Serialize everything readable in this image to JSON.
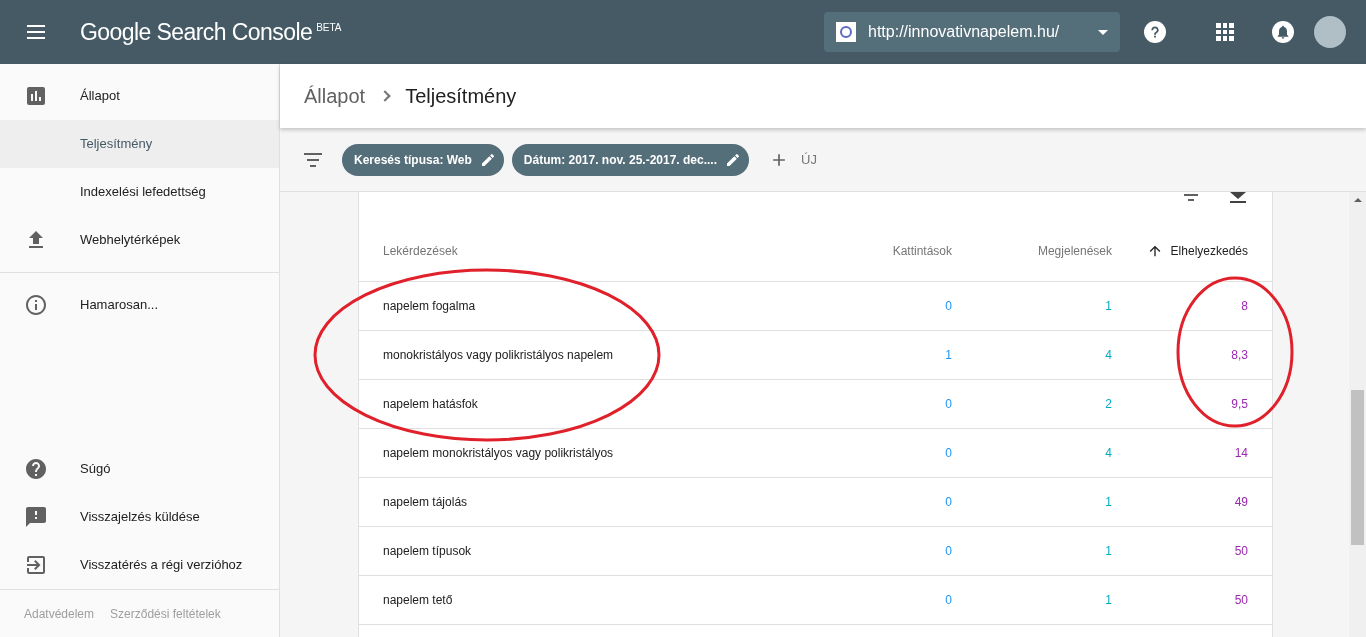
{
  "header": {
    "product": "Google Search Console",
    "badge": "BETA",
    "property": "http://innovativnapelem.hu/"
  },
  "sidebar": {
    "groups": [
      [
        {
          "label": "Állapot",
          "selected": false,
          "children": [
            {
              "label": "Teljesítmény",
              "selected": true
            },
            {
              "label": "Indexelési lefedettség",
              "selected": false
            }
          ]
        },
        {
          "label": "Webhelytérképek",
          "selected": false
        }
      ],
      [
        {
          "label": "Hamarosan...",
          "selected": false
        }
      ]
    ],
    "bottom": [
      {
        "label": "Súgó"
      },
      {
        "label": "Visszajelzés küldése"
      },
      {
        "label": "Visszatérés a régi verzióhoz"
      }
    ],
    "footer_links": [
      "Adatvédelem",
      "Szerződési feltételek"
    ]
  },
  "breadcrumb": [
    "Állapot",
    "Teljesítmény"
  ],
  "filters": {
    "chips": [
      "Keresés típusa: Web",
      "Dátum: 2017. nov. 25.-2017. dec...."
    ],
    "add_label": "ÚJ"
  },
  "table": {
    "columns": [
      {
        "label": "Lekérdezések",
        "sorted": false
      },
      {
        "label": "Kattintások",
        "sorted": false
      },
      {
        "label": "Megjelenések",
        "sorted": false
      },
      {
        "label": "Elhelyezkedés",
        "sorted": true
      }
    ],
    "rows": [
      [
        "napelem fogalma",
        "0",
        "1",
        "8"
      ],
      [
        "monokristályos vagy polikristályos napelem",
        "1",
        "4",
        "8,3"
      ],
      [
        "napelem hatásfok",
        "0",
        "2",
        "9,5"
      ],
      [
        "napelem monokristályos vagy polikristályos",
        "0",
        "4",
        "14"
      ],
      [
        "napelem tájolás",
        "0",
        "1",
        "49"
      ],
      [
        "napelem típusok",
        "0",
        "1",
        "50"
      ],
      [
        "napelem tető",
        "0",
        "1",
        "50"
      ]
    ]
  }
}
